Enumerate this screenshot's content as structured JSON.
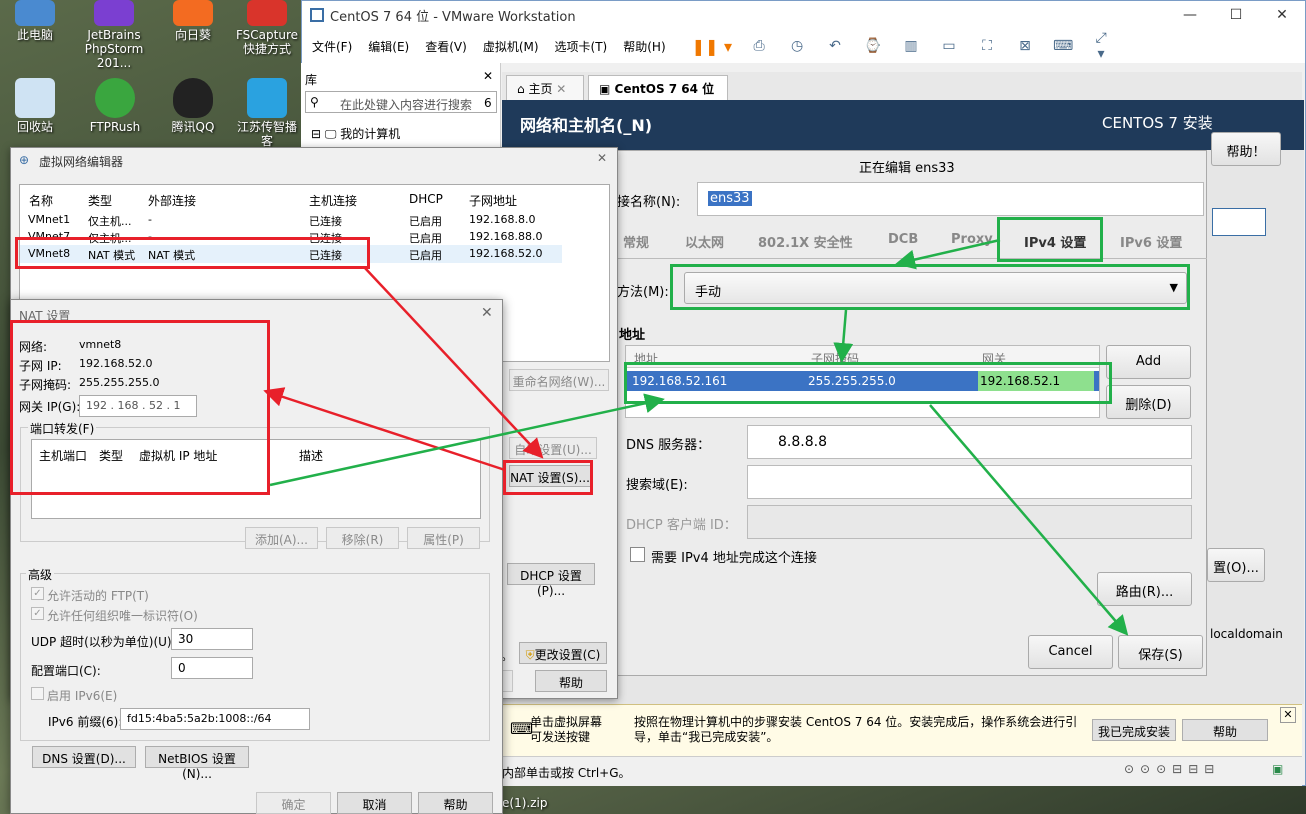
{
  "desktop": {
    "icons": [
      {
        "label": "此电脑"
      },
      {
        "label": "JetBrains PhpStorm 201..."
      },
      {
        "label": "向日葵"
      },
      {
        "label": "FSCapture 快捷方式"
      },
      {
        "label": "回收站"
      },
      {
        "label": "FTPRush"
      },
      {
        "label": "腾讯QQ"
      },
      {
        "label": "江苏传智播客"
      }
    ],
    "taskbar_file": "e(1).zip"
  },
  "vmware": {
    "title": "CentOS 7 64 位 - VMware Workstation",
    "menu": [
      "文件(F)",
      "编辑(E)",
      "查看(V)",
      "虚拟机(M)",
      "选项卡(T)",
      "帮助(H)"
    ],
    "library": {
      "title": "库",
      "search_placeholder": "在此处键入内容进行搜索",
      "search_count": "6",
      "tree_item": "我的计算机"
    },
    "tabs": [
      {
        "label": "主页"
      },
      {
        "label": "CentOS 7 64 位"
      }
    ],
    "installer": {
      "section_title": "网络和主机名(_N)",
      "product_title": "CENTOS 7 安装",
      "help_button": "帮助！",
      "side_button": "置(O)...",
      "side_text": "localdomain"
    },
    "infobar": {
      "hint": "单击虚拟屏幕\n可发送按键",
      "message": "按照在物理计算机中的步骤安装 CentOS 7 64 位。安装完成后，操作系统会进行引导，单击“我已完成安装”。",
      "done_button": "我已完成安装",
      "help_button": "帮助"
    },
    "statusbar": "内部单击或按 Ctrl+G。"
  },
  "ens_dialog": {
    "title": "正在编辑 ens33",
    "conn_name_label": "接名称(N):",
    "conn_name_value": "ens33",
    "tabs": [
      "常规",
      "以太网",
      "802.1X 安全性",
      "DCB",
      "Proxy",
      "IPv4 设置",
      "IPv6 设置"
    ],
    "method_label": "方法(M):",
    "method_value": "手动",
    "address_section": "地址",
    "columns": [
      "地址",
      "子网掩码",
      "网关"
    ],
    "row": {
      "address": "192.168.52.161",
      "netmask": "255.255.255.0",
      "gateway": "192.168.52.1"
    },
    "add_button": "Add",
    "delete_button": "删除(D)",
    "dns_label": "DNS 服务器：",
    "dns_value": "8.8.8.8",
    "search_label": "搜索域(E):",
    "dhcp_label": "DHCP 客户端 ID：",
    "require_label": "需要 IPv4 地址完成这个连接",
    "routes_button": "路由(R)...",
    "cancel_button": "Cancel",
    "save_button": "保存(S)"
  },
  "vne": {
    "title": "虚拟网络编辑器",
    "columns": [
      "名称",
      "类型",
      "外部连接",
      "主机连接",
      "DHCP",
      "子网地址"
    ],
    "rows": [
      {
        "name": "VMnet1",
        "type": "仅主机...",
        "ext": "-",
        "host": "已连接",
        "dhcp": "已启用",
        "subnet": "192.168.8.0"
      },
      {
        "name": "VMnet7",
        "type": "仅主机...",
        "ext": "-",
        "host": "已连接",
        "dhcp": "已启用",
        "subnet": "192.168.88.0"
      },
      {
        "name": "VMnet8",
        "type": "NAT 模式",
        "ext": "NAT 模式",
        "host": "已连接",
        "dhcp": "已启用",
        "subnet": "192.168.52.0"
      }
    ],
    "rename_button": "重命名网络(W)...",
    "auto_button": "自动设置(U)...",
    "nat_button": "NAT 设置(S)...",
    "dhcp_button": "DHCP 设置(P)...",
    "change_button": "更改设置(C)",
    "help_button": "帮助",
    "small_label": "。"
  },
  "nat": {
    "title": "NAT 设置",
    "network_label": "网络:",
    "network_value": "vmnet8",
    "subnet_ip_label": "子网 IP:",
    "subnet_ip_value": "192.168.52.0",
    "mask_label": "子网掩码:",
    "mask_value": "255.255.255.0",
    "gateway_label": "网关 IP(G):",
    "gateway_value": "192 . 168 . 52 . 1",
    "port_forward_group": "端口转发(F)",
    "pf_columns": [
      "主机端口",
      "类型",
      "虚拟机 IP 地址",
      "描述"
    ],
    "add_button": "添加(A)...",
    "remove_button": "移除(R)",
    "props_button": "属性(P)",
    "advanced_group": "高级",
    "ftp_check": "允许活动的 FTP(T)",
    "oui_check": "允许任何组织唯一标识符(O)",
    "udp_label": "UDP 超时(以秒为单位)(U):",
    "udp_value": "30",
    "config_port_label": "配置端口(C):",
    "config_port_value": "0",
    "ipv6_check": "启用 IPv6(E)",
    "ipv6_prefix_label": "IPv6 前缀(6):",
    "ipv6_prefix_value": "fd15:4ba5:5a2b:1008::/64",
    "dns_button": "DNS 设置(D)...",
    "netbios_button": "NetBIOS 设置(N)...",
    "ok_button": "确定",
    "cancel_button": "取消",
    "help_button": "帮助"
  }
}
